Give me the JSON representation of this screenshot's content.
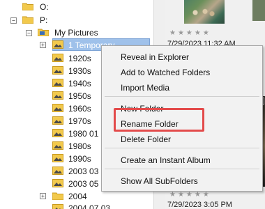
{
  "tree": {
    "rows": [
      {
        "label": "O:",
        "has_expander": false,
        "expander": ""
      },
      {
        "label": "P:",
        "has_expander": true,
        "expander": "−"
      },
      {
        "label": "My Pictures",
        "has_expander": true,
        "expander": "−"
      },
      {
        "label": "1 Temporary",
        "has_expander": true,
        "expander": "+",
        "selected": true
      },
      {
        "label": "1920s"
      },
      {
        "label": "1930s"
      },
      {
        "label": "1940s"
      },
      {
        "label": "1950s"
      },
      {
        "label": "1960s"
      },
      {
        "label": "1970s"
      },
      {
        "label": "1980 01"
      },
      {
        "label": "1980s"
      },
      {
        "label": "1990s"
      },
      {
        "label": "2003 03"
      },
      {
        "label": "2003 05"
      },
      {
        "label": "2004",
        "has_expander": true,
        "expander": "+"
      },
      {
        "label": "2004 07 03"
      }
    ]
  },
  "right_pane": {
    "stars": "★★★★★",
    "dates": [
      "7/29/2023 11:32 AM",
      "7/29/2023 3:05 PM"
    ]
  },
  "context_menu": {
    "items": [
      "Reveal in Explorer",
      "Add to Watched Folders",
      "Import Media",
      "New Folder",
      "Rename Folder",
      "Delete Folder",
      "Create an Instant Album",
      "Show All SubFolders"
    ],
    "highlighted": "Rename Folder"
  },
  "colors": {
    "selection": "#9fc1ea",
    "folder": "#f2c94c",
    "highlight_box": "#e34b4b"
  }
}
